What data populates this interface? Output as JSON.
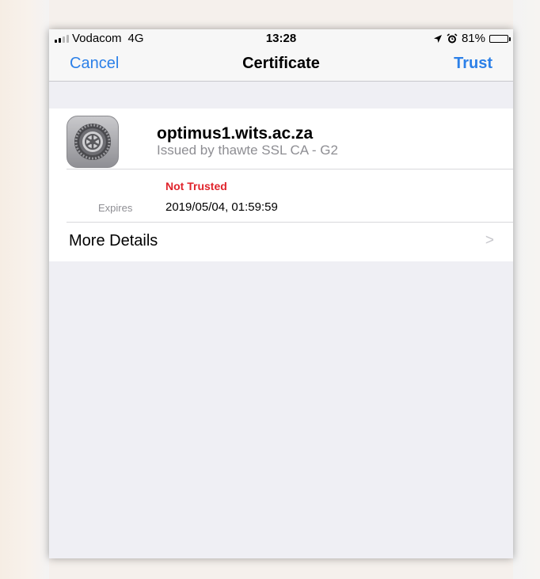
{
  "status_bar": {
    "carrier": "Vodacom",
    "network": "4G",
    "time": "13:28",
    "battery": "81%",
    "signal_bars": 4,
    "signal_bars_filled": 2
  },
  "nav": {
    "cancel_label": "Cancel",
    "title": "Certificate",
    "trust_label": "Trust"
  },
  "certificate": {
    "icon": "settings-gear-icon",
    "name": "optimus1.wits.ac.za",
    "issuer": "Issued by thawte SSL CA - G2",
    "trust_status": "Not Trusted",
    "expires_label": "Expires",
    "expires_value": "2019/05/04, 01:59:59"
  },
  "more_details": {
    "label": "More Details",
    "chevron": ">"
  },
  "colors": {
    "accent": "#2c80e8",
    "warning": "#e0232b",
    "secondary_text": "#8e8e93",
    "background": "#efeff4"
  }
}
